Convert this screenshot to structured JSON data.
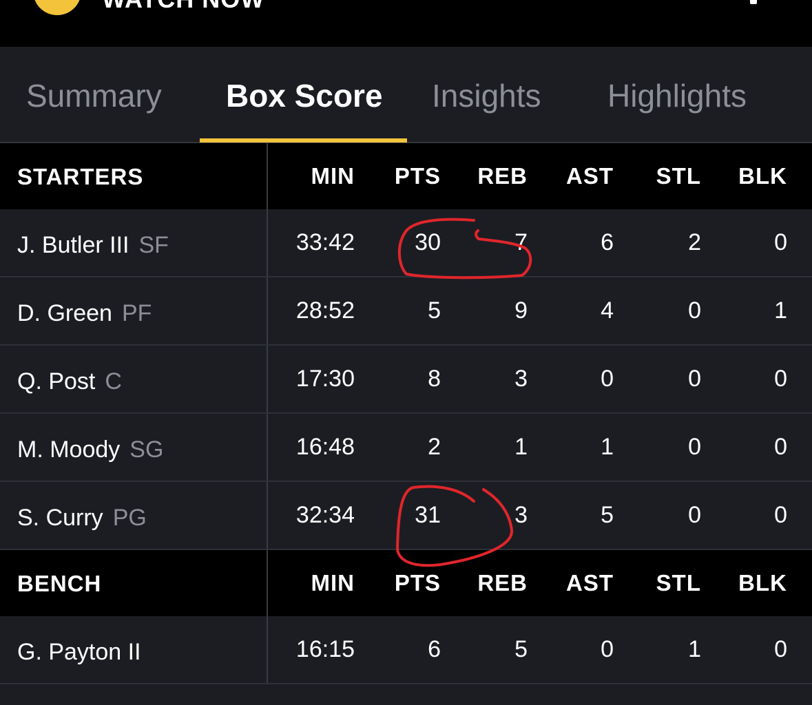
{
  "header": {
    "watch_label": "WATCH NOW",
    "watch_icon": "play-icon",
    "more_icon": "more-icon"
  },
  "tabs": [
    {
      "label": "Summary",
      "active": false
    },
    {
      "label": "Box Score",
      "active": true
    },
    {
      "label": "Insights",
      "active": false
    },
    {
      "label": "Highlights",
      "active": false
    }
  ],
  "accent_color": "#f3c33b",
  "annotation_color": "#e0262b",
  "columns": [
    "MIN",
    "PTS",
    "REB",
    "AST",
    "STL",
    "BLK"
  ],
  "starters": {
    "title": "STARTERS",
    "rows": [
      {
        "name": "J. Butler III",
        "pos": "SF",
        "min": "33:42",
        "pts": "30",
        "reb": "7",
        "ast": "6",
        "stl": "2",
        "blk": "0"
      },
      {
        "name": "D. Green",
        "pos": "PF",
        "min": "28:52",
        "pts": "5",
        "reb": "9",
        "ast": "4",
        "stl": "0",
        "blk": "1"
      },
      {
        "name": "Q. Post",
        "pos": "C",
        "min": "17:30",
        "pts": "8",
        "reb": "3",
        "ast": "0",
        "stl": "0",
        "blk": "0"
      },
      {
        "name": "M. Moody",
        "pos": "SG",
        "min": "16:48",
        "pts": "2",
        "reb": "1",
        "ast": "1",
        "stl": "0",
        "blk": "0"
      },
      {
        "name": "S. Curry",
        "pos": "PG",
        "min": "32:34",
        "pts": "31",
        "reb": "3",
        "ast": "5",
        "stl": "0",
        "blk": "0"
      }
    ]
  },
  "bench": {
    "title": "BENCH",
    "rows": [
      {
        "name": "G. Payton II",
        "pos": "",
        "min": "16:15",
        "pts": "6",
        "reb": "5",
        "ast": "0",
        "stl": "1",
        "blk": "0"
      }
    ]
  }
}
